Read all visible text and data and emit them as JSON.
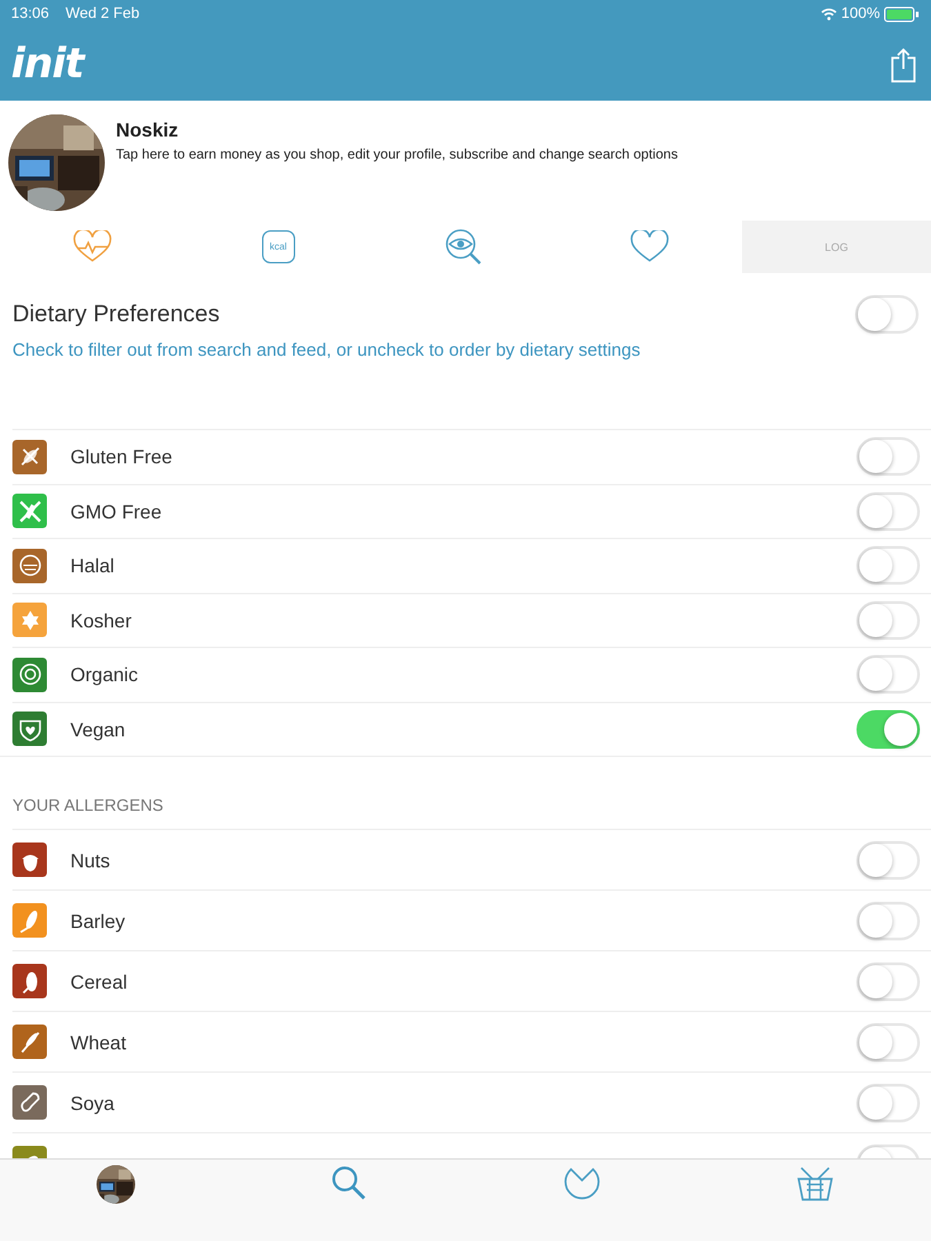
{
  "status_bar": {
    "time": "13:06",
    "date": "Wed 2 Feb",
    "battery": "100%"
  },
  "nav_bar": {
    "logo": "init"
  },
  "profile": {
    "name": "Noskiz",
    "hint": "Tap here to earn money as you shop, edit your profile, subscribe and change search options"
  },
  "tabs": [
    {
      "selected": true
    },
    {
      "label": "kcal",
      "selected": false
    },
    {
      "selected": false
    },
    {
      "selected": false
    },
    {
      "label": "LOG",
      "selected": false
    }
  ],
  "dietary": {
    "title": "Dietary Preferences",
    "on": false,
    "subtitle": "Check to filter out from search and feed, or uncheck to order by dietary settings"
  },
  "preferences": [
    {
      "name": "Gluten Free",
      "color": "#a8662a",
      "on": false
    },
    {
      "name": "GMO Free",
      "color": "#2fbf4a",
      "on": false
    },
    {
      "name": "Halal",
      "color": "#a8662a",
      "on": false
    },
    {
      "name": "Kosher",
      "color": "#f5a33c",
      "on": false
    },
    {
      "name": "Organic",
      "color": "#2e8a34",
      "on": false
    },
    {
      "name": "Vegan",
      "color": "#2e7d32",
      "on": true
    }
  ],
  "allergens_header": "YOUR ALLERGENS",
  "allergens": [
    {
      "name": "Nuts",
      "color": "#a8361c",
      "on": false
    },
    {
      "name": "Barley",
      "color": "#f2911f",
      "on": false
    },
    {
      "name": "Cereal",
      "color": "#a8361c",
      "on": false
    },
    {
      "name": "Wheat",
      "color": "#b0641c",
      "on": false
    },
    {
      "name": "Soya",
      "color": "#7a6a5c",
      "on": false
    },
    {
      "color": "#8a8a1c",
      "on": false
    }
  ]
}
